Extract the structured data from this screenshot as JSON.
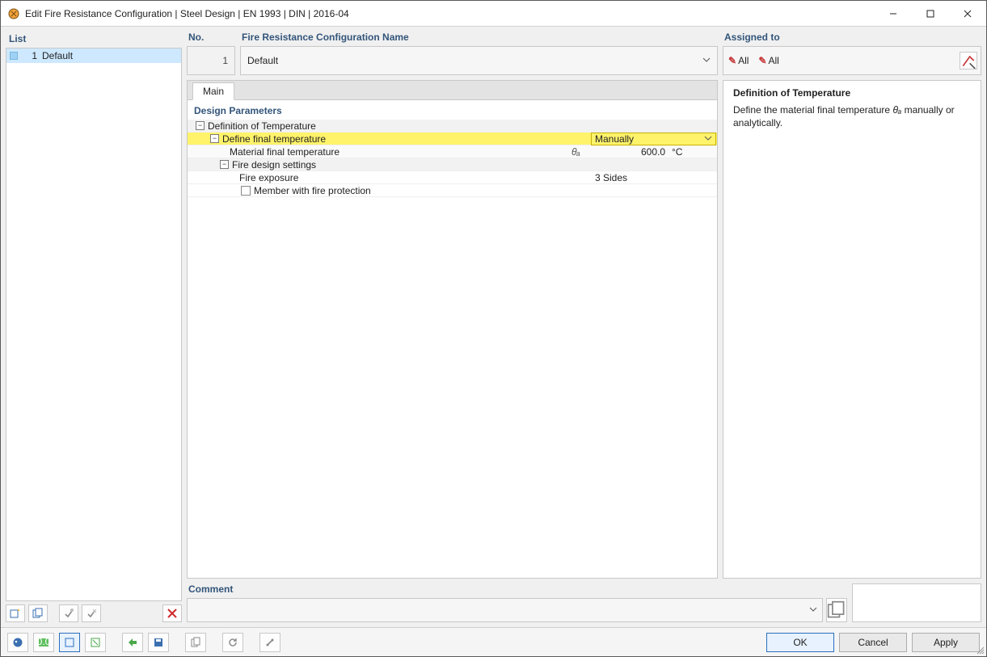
{
  "window": {
    "title": "Edit Fire Resistance Configuration | Steel Design | EN 1993 | DIN | 2016-04"
  },
  "left": {
    "header": "List",
    "items": [
      {
        "num": "1",
        "label": "Default"
      }
    ]
  },
  "top": {
    "no_header": "No.",
    "no_value": "1",
    "name_header": "Fire Resistance Configuration Name",
    "name_value": "Default",
    "assigned_header": "Assigned to",
    "assigned_all_1": "All",
    "assigned_all_2": "All"
  },
  "tab": {
    "main": "Main"
  },
  "params": {
    "header": "Design Parameters",
    "def_temp_group": "Definition of Temperature",
    "define_final_temp": "Define final temperature",
    "define_final_temp_value": "Manually",
    "material_final_temp": "Material final temperature",
    "material_final_temp_symbol": "θₐ",
    "material_final_temp_value": "600.0",
    "material_final_temp_unit": "°C",
    "fire_settings_group": "Fire design settings",
    "fire_exposure": "Fire exposure",
    "fire_exposure_value": "3 Sides",
    "member_protection": "Member with fire protection"
  },
  "info": {
    "title": "Definition of Temperature",
    "text_pre": "Define the material final temperature ",
    "text_sym": "θₐ",
    "text_post": " manually or analytically."
  },
  "comment": {
    "header": "Comment",
    "value": ""
  },
  "footer": {
    "ok": "OK",
    "cancel": "Cancel",
    "apply": "Apply"
  }
}
